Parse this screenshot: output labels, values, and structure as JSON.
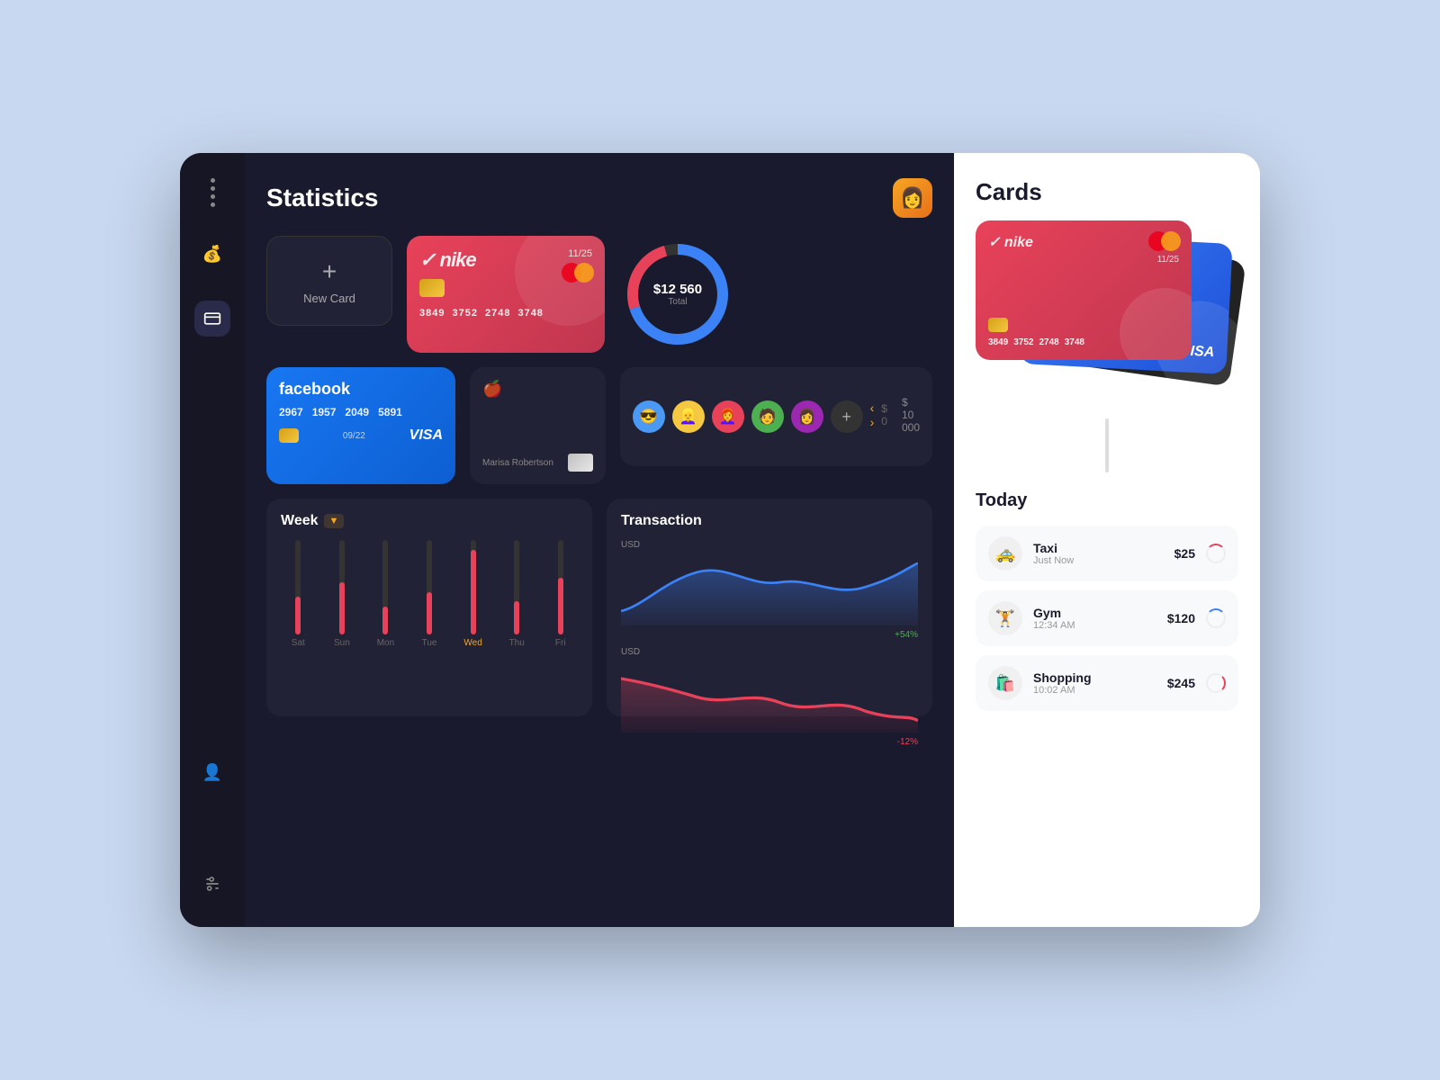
{
  "header": {
    "title": "Statistics",
    "avatar_emoji": "👩"
  },
  "new_card": {
    "label": "New Card",
    "plus": "+"
  },
  "nike_card": {
    "brand": "✓ nike",
    "expiry": "11/25",
    "numbers": [
      "3849",
      "3752",
      "2748",
      "3748"
    ]
  },
  "donut": {
    "amount": "$12 560",
    "label": "Total"
  },
  "facebook_card": {
    "label": "facebook",
    "numbers": [
      "2967",
      "1957",
      "2049",
      "5891"
    ],
    "expiry": "09/22",
    "network": "VISA"
  },
  "apple_card": {
    "name": "Marisa Robertson"
  },
  "people": {
    "add_label": "+",
    "range_start": "$ 0",
    "range_end": "$ 10 000"
  },
  "week_chart": {
    "title": "Week",
    "filter": "▼",
    "days": [
      "Sat",
      "Sun",
      "Mon",
      "Tue",
      "Wed",
      "Thu",
      "Fri"
    ],
    "heights": [
      40,
      55,
      30,
      45,
      90,
      35,
      60
    ],
    "active_day": "Wed"
  },
  "transaction_chart": {
    "title": "Transaction",
    "usd_label": "USD",
    "usd_label2": "USD",
    "percent1": "+54%",
    "percent2": "-12%"
  },
  "cards_panel": {
    "title": "Cards",
    "red_card": {
      "numbers": [
        "3849",
        "3752",
        "2748",
        "3748"
      ],
      "expiry": "11/25"
    },
    "blue_card": {
      "network": "VISA"
    },
    "black_card": {}
  },
  "today": {
    "title": "Today",
    "transactions": [
      {
        "name": "Taxi",
        "time": "Just Now",
        "amount": "$25",
        "icon": "🚕",
        "status": "red"
      },
      {
        "name": "Gym",
        "time": "12:34 AM",
        "amount": "$120",
        "icon": "🏋️",
        "status": "blue"
      },
      {
        "name": "Shopping",
        "time": "10:02 AM",
        "amount": "$245",
        "icon": "🛍️",
        "status": "red2"
      }
    ]
  }
}
